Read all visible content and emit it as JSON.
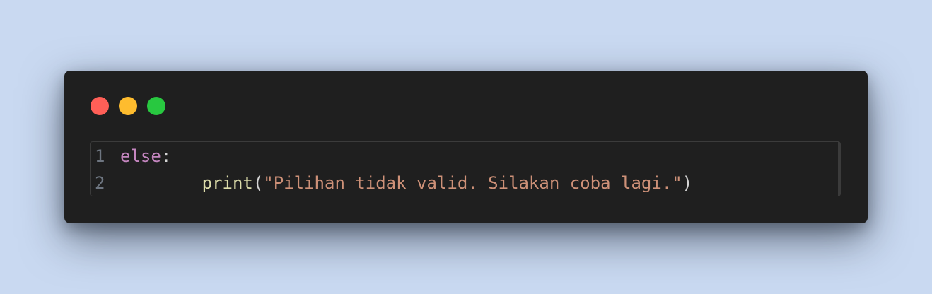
{
  "window": {
    "controls": [
      {
        "name": "close",
        "color": "#ff5f57"
      },
      {
        "name": "minimize",
        "color": "#febc2e"
      },
      {
        "name": "maximize",
        "color": "#28c840"
      }
    ]
  },
  "editor": {
    "lines": [
      {
        "number": "1",
        "indent": "",
        "keyword": "else",
        "punct": ":"
      },
      {
        "number": "2",
        "indent": "        ",
        "function": "print",
        "open_paren": "(",
        "string": "\"Pilihan tidak valid. Silakan coba lagi.\"",
        "close_paren": ")"
      }
    ]
  },
  "colors": {
    "background": "#c9d9f1",
    "window": "#1f1f1f",
    "keyword": "#c586c0",
    "function": "#dcdcaa",
    "string": "#ce9178",
    "line_number": "#6e7681"
  }
}
